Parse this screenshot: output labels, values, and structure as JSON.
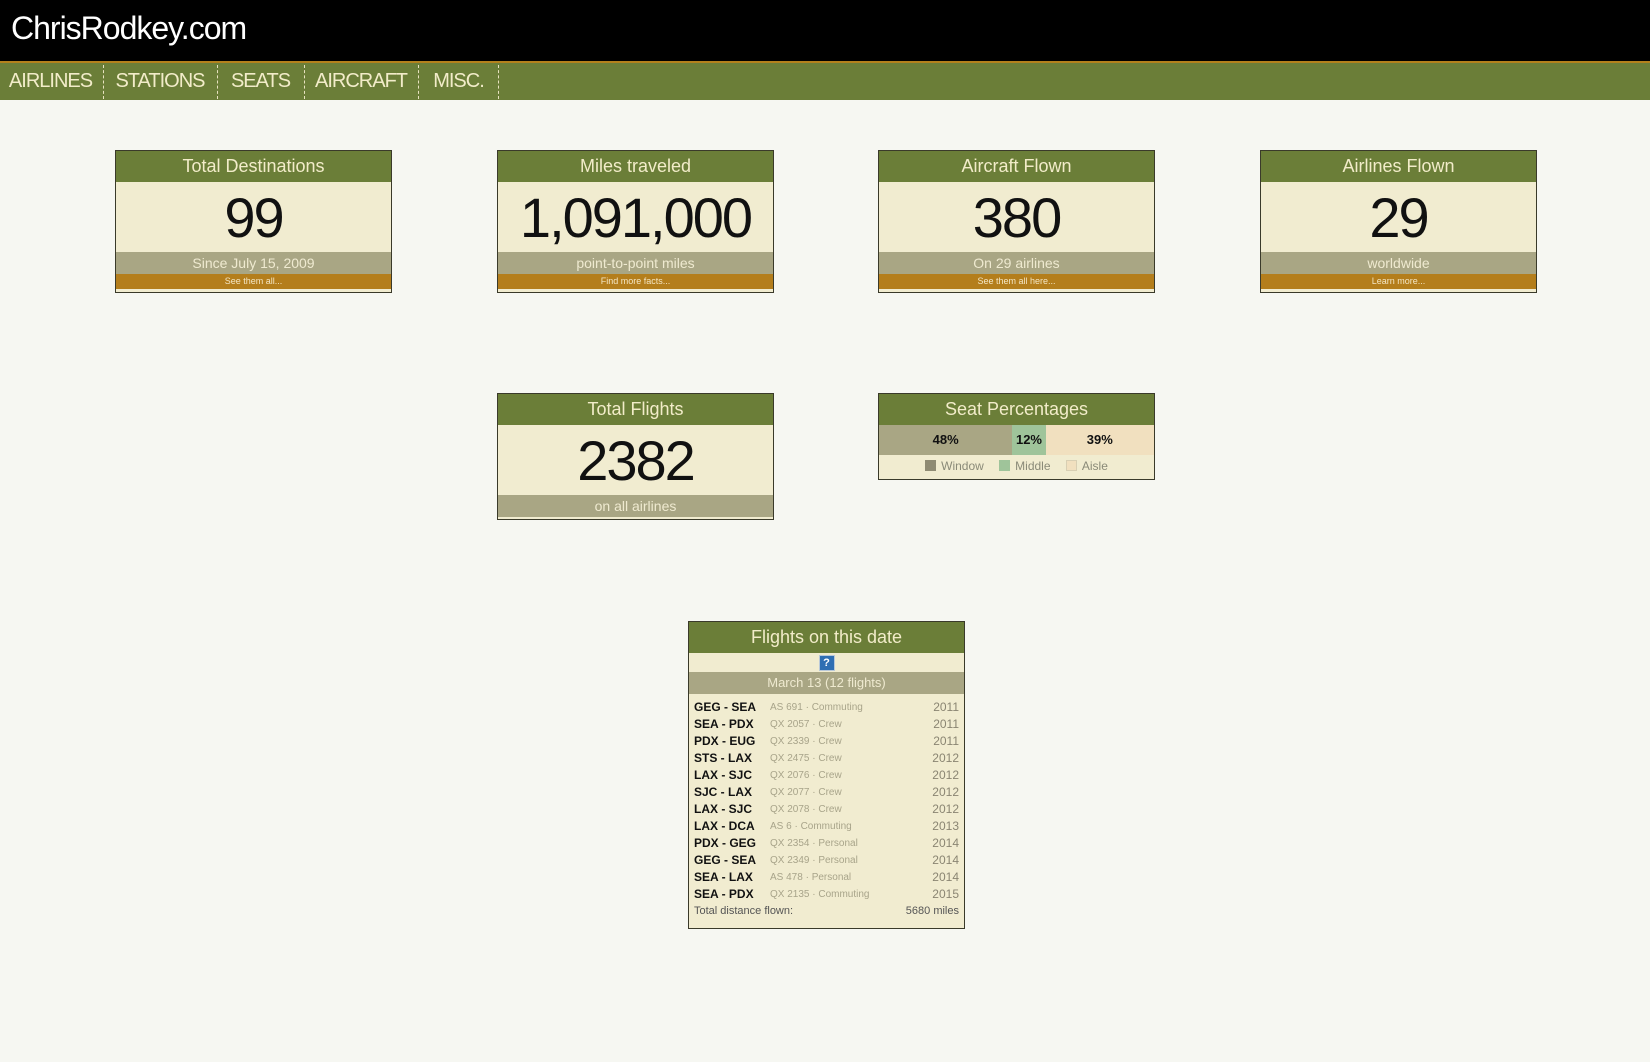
{
  "site": {
    "title": "ChrisRodkey.com"
  },
  "nav": {
    "items": [
      "AIRLINES",
      "STATIONS",
      "SEATS",
      "AIRCRAFT",
      "MISC."
    ]
  },
  "cards": {
    "destinations": {
      "title": "Total Destinations",
      "value": "99",
      "subtitle": "Since July 15, 2009",
      "link": "See them all..."
    },
    "miles": {
      "title": "Miles traveled",
      "value": "1,091,000",
      "subtitle": "point-to-point miles",
      "link": "Find more facts..."
    },
    "aircraft": {
      "title": "Aircraft Flown",
      "value": "380",
      "subtitle": "On 29 airlines",
      "link": "See them all here..."
    },
    "airlines": {
      "title": "Airlines Flown",
      "value": "29",
      "subtitle": "worldwide",
      "link": "Learn more..."
    },
    "flights": {
      "title": "Total Flights",
      "value": "2382",
      "subtitle": "on all airlines"
    }
  },
  "seats": {
    "title": "Seat Percentages",
    "segments": [
      {
        "label": "48%",
        "name": "Window",
        "percent": 48,
        "color": "#a9a684"
      },
      {
        "label": "12%",
        "name": "Middle",
        "percent": 12,
        "color": "#9fc49a"
      },
      {
        "label": "39%",
        "name": "Aisle",
        "percent": 39,
        "color": "#f1e0bf"
      }
    ]
  },
  "on_this_date": {
    "title": "Flights on this date",
    "help_icon": "?",
    "date_label": "March 13 (12 flights)",
    "flights": [
      {
        "route": "GEG - SEA",
        "info": "AS 691 · Commuting",
        "year": "2011"
      },
      {
        "route": "SEA - PDX",
        "info": "QX 2057 · Crew",
        "year": "2011"
      },
      {
        "route": "PDX - EUG",
        "info": "QX 2339 · Crew",
        "year": "2011"
      },
      {
        "route": "STS - LAX",
        "info": "QX 2475 · Crew",
        "year": "2012"
      },
      {
        "route": "LAX - SJC",
        "info": "QX 2076 · Crew",
        "year": "2012"
      },
      {
        "route": "SJC - LAX",
        "info": "QX 2077 · Crew",
        "year": "2012"
      },
      {
        "route": "LAX - SJC",
        "info": "QX 2078 · Crew",
        "year": "2012"
      },
      {
        "route": "LAX - DCA",
        "info": "AS 6 · Commuting",
        "year": "2013"
      },
      {
        "route": "PDX - GEG",
        "info": "QX 2354 · Personal",
        "year": "2014"
      },
      {
        "route": "GEG - SEA",
        "info": "QX 2349 · Personal",
        "year": "2014"
      },
      {
        "route": "SEA - LAX",
        "info": "AS 478 · Personal",
        "year": "2014"
      },
      {
        "route": "SEA - PDX",
        "info": "QX 2135 · Commuting",
        "year": "2015"
      }
    ],
    "total_label": "Total distance flown:",
    "total_value": "5680 miles"
  }
}
